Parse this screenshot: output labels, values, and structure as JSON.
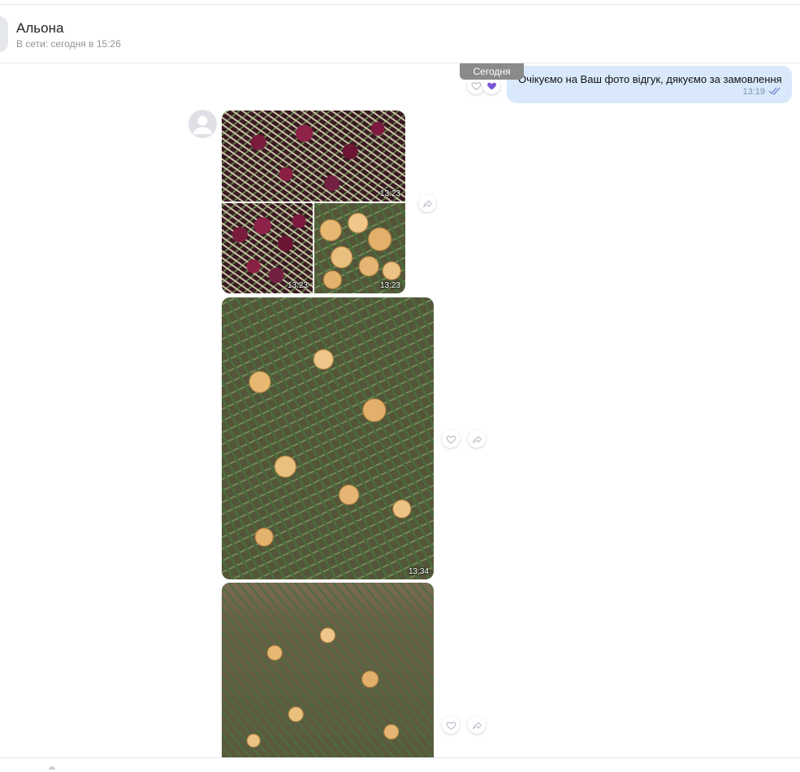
{
  "header": {
    "contact_name": "Альона",
    "status": "В сети: сегодня в 15:26"
  },
  "date_separator": "Сегодня",
  "outgoing_message": {
    "text": "Очікуємо на Ваш фото відгук, дякуємо за замовлення",
    "time": "13:19",
    "status_icon": "double-check-icon",
    "reaction_icon": "heart-icon",
    "reaction_color": "#7a54d6"
  },
  "incoming": {
    "avatar_icon": "user-placeholder-icon",
    "photos": [
      {
        "name": "photo-red-onions-large",
        "time": "13:23"
      },
      {
        "name": "photo-red-onions-small",
        "time": "13:23"
      },
      {
        "name": "photo-yellow-onions-small",
        "time": "13:23"
      },
      {
        "name": "photo-yellow-onions-big",
        "time": "13:34"
      },
      {
        "name": "photo-onions-on-soil",
        "time": ""
      }
    ]
  },
  "icons": {
    "like": "heart-icon",
    "forward": "share-arrow-icon"
  },
  "colors": {
    "outgoing_bubble": "#d9e9fb",
    "date_badge": "#8a8a8a",
    "status_text": "#939393"
  }
}
